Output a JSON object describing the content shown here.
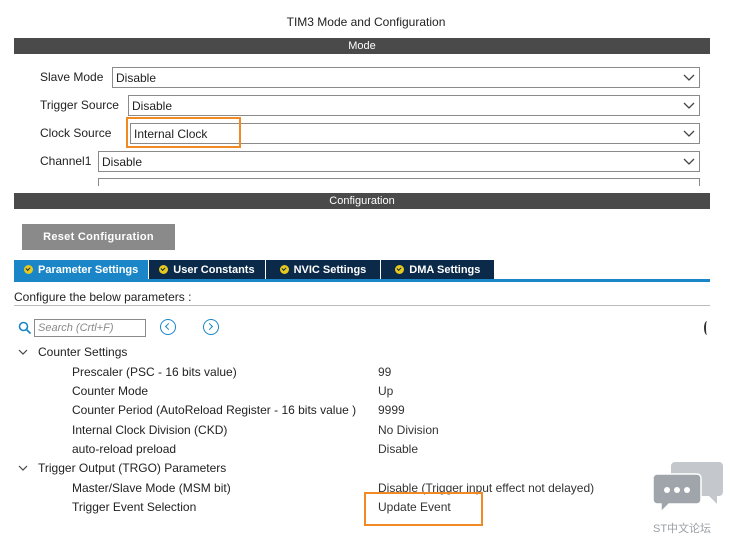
{
  "title": "TIM3 Mode and Configuration",
  "sections": {
    "mode": "Mode",
    "configuration": "Configuration"
  },
  "mode_fields": [
    {
      "label": "Slave Mode",
      "value": "Disable"
    },
    {
      "label": "Trigger Source",
      "value": "Disable"
    },
    {
      "label": "Clock Source",
      "value": "Internal Clock"
    },
    {
      "label": "Channel1",
      "value": "Disable"
    }
  ],
  "reset_button": "Reset Configuration",
  "tabs": [
    {
      "label": "Parameter Settings",
      "active": true
    },
    {
      "label": "User Constants",
      "active": false
    },
    {
      "label": "NVIC Settings",
      "active": false
    },
    {
      "label": "DMA Settings",
      "active": false
    }
  ],
  "configure_text": "Configure the below parameters :",
  "search": {
    "placeholder": "Search (Crtl+F)"
  },
  "groups": [
    {
      "name": "Counter Settings",
      "params": [
        {
          "name": "Prescaler (PSC - 16 bits value)",
          "value": "99"
        },
        {
          "name": "Counter Mode",
          "value": "Up"
        },
        {
          "name": "Counter Period (AutoReload Register - 16 bits value )",
          "value": "9999"
        },
        {
          "name": "Internal Clock Division (CKD)",
          "value": "No Division"
        },
        {
          "name": "auto-reload preload",
          "value": "Disable"
        }
      ]
    },
    {
      "name": "Trigger Output (TRGO) Parameters",
      "params": [
        {
          "name": "Master/Slave Mode (MSM bit)",
          "value": "Disable (Trigger input effect not delayed)"
        },
        {
          "name": "Trigger Event Selection",
          "value": "Update Event"
        }
      ]
    }
  ],
  "watermark": "ST中文论坛",
  "colors": {
    "highlight": "#f08a24",
    "tab_active": "#1a86c8",
    "tab_inactive": "#0b2a4a",
    "section_bar": "#4a4a4a"
  }
}
